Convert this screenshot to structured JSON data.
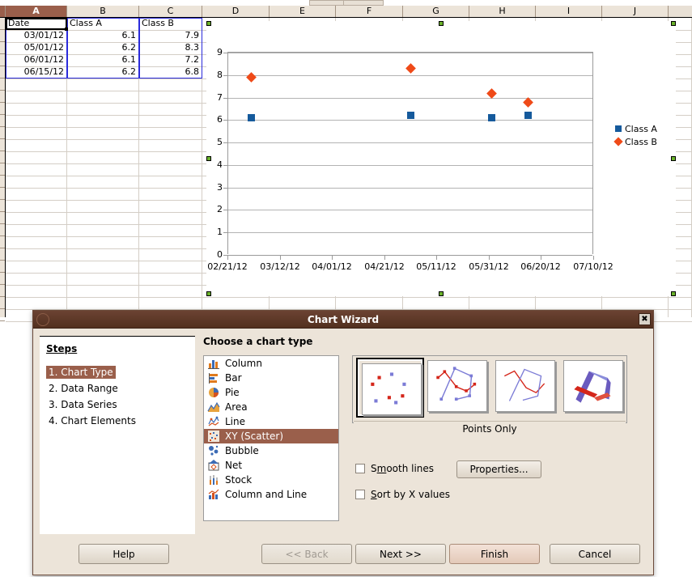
{
  "spreadsheet": {
    "column_headers": [
      "A",
      "B",
      "C",
      "D",
      "E",
      "F",
      "G",
      "H",
      "I",
      "J"
    ],
    "selected_column": "A",
    "table_headers": [
      "Date",
      "Class A",
      "Class B"
    ],
    "rows": [
      {
        "date": "03/01/12",
        "class_a": "6.1",
        "class_b": "7.9"
      },
      {
        "date": "05/01/12",
        "class_a": "6.2",
        "class_b": "8.3"
      },
      {
        "date": "06/01/12",
        "class_a": "6.1",
        "class_b": "7.2"
      },
      {
        "date": "06/15/12",
        "class_a": "6.2",
        "class_b": "6.8"
      }
    ]
  },
  "chart_data": {
    "type": "scatter",
    "title": "",
    "xlabel": "",
    "ylabel": "",
    "ylim": [
      0,
      9
    ],
    "yticks": [
      0,
      1,
      2,
      3,
      4,
      5,
      6,
      7,
      8,
      9
    ],
    "xticks": [
      "02/21/12",
      "03/12/12",
      "04/01/12",
      "04/21/12",
      "05/11/12",
      "05/31/12",
      "06/20/12",
      "07/10/12"
    ],
    "grid": true,
    "legend_position": "right",
    "series": [
      {
        "name": "Class A",
        "marker": "square",
        "color": "#155a9c",
        "x": [
          "03/01/12",
          "05/01/12",
          "06/01/12",
          "06/15/12"
        ],
        "values": [
          6.1,
          6.2,
          6.1,
          6.2
        ]
      },
      {
        "name": "Class B",
        "marker": "diamond",
        "color": "#ef4a18",
        "x": [
          "03/01/12",
          "05/01/12",
          "06/01/12",
          "06/15/12"
        ],
        "values": [
          7.9,
          8.3,
          7.2,
          6.8
        ]
      }
    ]
  },
  "dialog": {
    "title": "Chart Wizard",
    "close_label": "✖",
    "steps_heading": "Steps",
    "steps": [
      {
        "label": "1. Chart Type",
        "active": true
      },
      {
        "label": "2. Data Range",
        "active": false
      },
      {
        "label": "3. Data Series",
        "active": false
      },
      {
        "label": "4. Chart Elements",
        "active": false
      }
    ],
    "pane_title": "Choose a chart type",
    "chart_types": [
      {
        "label": "Column",
        "icon": "column-chart-icon",
        "selected": false
      },
      {
        "label": "Bar",
        "icon": "bar-chart-icon",
        "selected": false
      },
      {
        "label": "Pie",
        "icon": "pie-chart-icon",
        "selected": false
      },
      {
        "label": "Area",
        "icon": "area-chart-icon",
        "selected": false
      },
      {
        "label": "Line",
        "icon": "line-chart-icon",
        "selected": false
      },
      {
        "label": "XY (Scatter)",
        "icon": "scatter-chart-icon",
        "selected": true
      },
      {
        "label": "Bubble",
        "icon": "bubble-chart-icon",
        "selected": false
      },
      {
        "label": "Net",
        "icon": "net-chart-icon",
        "selected": false
      },
      {
        "label": "Stock",
        "icon": "stock-chart-icon",
        "selected": false
      },
      {
        "label": "Column and Line",
        "icon": "column-line-chart-icon",
        "selected": false
      }
    ],
    "variant_label": "Points Only",
    "variants": [
      {
        "name": "points-only",
        "selected": true
      },
      {
        "name": "points-and-lines",
        "selected": false
      },
      {
        "name": "lines-only",
        "selected": false
      },
      {
        "name": "3d-lines",
        "selected": false
      }
    ],
    "smooth_lines_label": "Smooth lines",
    "smooth_lines_checked": false,
    "properties_label": "Properties...",
    "sort_by_x_label": "Sort by X values",
    "sort_by_x_checked": false,
    "buttons": {
      "help": "Help",
      "back": "<< Back",
      "next": "Next >>",
      "finish": "Finish",
      "cancel": "Cancel"
    }
  },
  "colors": {
    "accent": "#9a5f4b",
    "titlebar": "#52301f",
    "series_a": "#155a9c",
    "series_b": "#ef4a18",
    "dialog_bg": "#ece4d9"
  }
}
